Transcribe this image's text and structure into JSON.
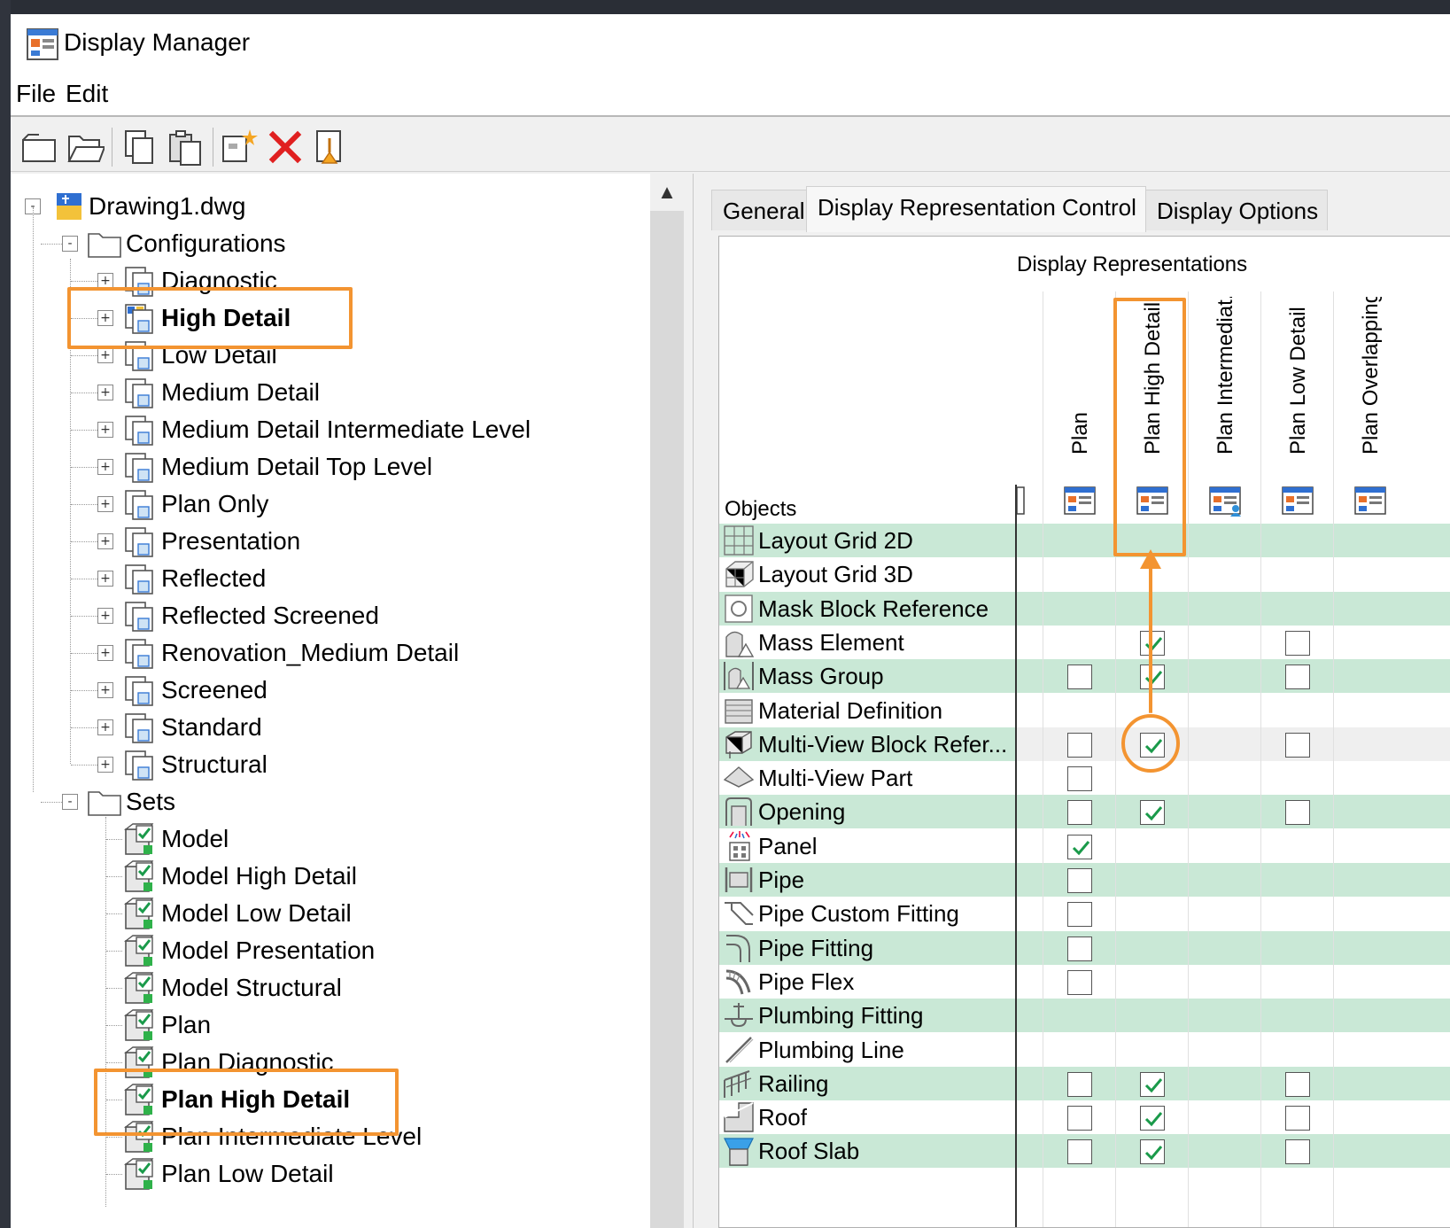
{
  "window": {
    "title": "Display Manager",
    "menu": [
      "File",
      "Edit"
    ],
    "toolbar": [
      "new-icon",
      "open-icon",
      "copy-icon",
      "paste-icon",
      "new-representation-icon",
      "delete-icon",
      "purge-icon"
    ]
  },
  "tree": {
    "root": "Drawing1.dwg",
    "configurations_label": "Configurations",
    "configurations": [
      "Diagnostic",
      "High Detail",
      "Low Detail",
      "Medium Detail",
      "Medium Detail Intermediate Level",
      "Medium Detail Top Level",
      "Plan Only",
      "Presentation",
      "Reflected",
      "Reflected Screened",
      "Renovation_Medium Detail",
      "Screened",
      "Standard",
      "Structural"
    ],
    "current_configuration": "High Detail",
    "sets_label": "Sets",
    "sets": [
      "Model",
      "Model High Detail",
      "Model Low Detail",
      "Model Presentation",
      "Model Structural",
      "Plan",
      "Plan Diagnostic",
      "Plan High Detail",
      "Plan Intermediate Level",
      "Plan Low Detail"
    ],
    "selected_set": "Plan High Detail"
  },
  "tabs": [
    "General",
    "Display Representation Control",
    "Display Options"
  ],
  "active_tab": "Display Representation Control",
  "grid": {
    "header": "Display Representations",
    "objects_label": "Objects",
    "columns": [
      "Plan",
      "Plan High Detail",
      "Plan Intermediat...",
      "Plan Low Detail",
      "Plan Overlapping"
    ],
    "rows": [
      {
        "name": "Layout Grid 2D",
        "icon": "layout-grid-2d-icon",
        "cells": [
          null,
          null,
          null,
          null,
          null
        ]
      },
      {
        "name": "Layout Grid 3D",
        "icon": "layout-grid-3d-icon",
        "cells": [
          null,
          null,
          null,
          null,
          null
        ]
      },
      {
        "name": "Mask Block Reference",
        "icon": "mask-block-icon",
        "cells": [
          null,
          null,
          null,
          null,
          null
        ]
      },
      {
        "name": "Mass Element",
        "icon": "mass-element-icon",
        "cells": [
          null,
          true,
          null,
          false,
          null
        ]
      },
      {
        "name": "Mass Group",
        "icon": "mass-group-icon",
        "cells": [
          false,
          true,
          null,
          false,
          null
        ]
      },
      {
        "name": "Material Definition",
        "icon": "material-definition-icon",
        "cells": [
          null,
          null,
          null,
          null,
          null
        ]
      },
      {
        "name": "Multi-View Block Refer...",
        "icon": "multi-view-block-icon",
        "cells": [
          false,
          true,
          null,
          false,
          null
        ]
      },
      {
        "name": "Multi-View Part",
        "icon": "multi-view-part-icon",
        "cells": [
          false,
          null,
          null,
          null,
          null
        ]
      },
      {
        "name": "Opening",
        "icon": "opening-icon",
        "cells": [
          false,
          true,
          null,
          false,
          null
        ]
      },
      {
        "name": "Panel",
        "icon": "panel-icon",
        "cells": [
          true,
          null,
          null,
          null,
          null
        ]
      },
      {
        "name": "Pipe",
        "icon": "pipe-icon",
        "cells": [
          false,
          null,
          null,
          null,
          null
        ]
      },
      {
        "name": "Pipe Custom Fitting",
        "icon": "pipe-custom-fitting-icon",
        "cells": [
          false,
          null,
          null,
          null,
          null
        ]
      },
      {
        "name": "Pipe Fitting",
        "icon": "pipe-fitting-icon",
        "cells": [
          false,
          null,
          null,
          null,
          null
        ]
      },
      {
        "name": "Pipe Flex",
        "icon": "pipe-flex-icon",
        "cells": [
          false,
          null,
          null,
          null,
          null
        ]
      },
      {
        "name": "Plumbing Fitting",
        "icon": "plumbing-fitting-icon",
        "cells": [
          null,
          null,
          null,
          null,
          null
        ]
      },
      {
        "name": "Plumbing Line",
        "icon": "plumbing-line-icon",
        "cells": [
          null,
          null,
          null,
          null,
          null
        ]
      },
      {
        "name": "Railing",
        "icon": "railing-icon",
        "cells": [
          false,
          true,
          null,
          false,
          null
        ]
      },
      {
        "name": "Roof",
        "icon": "roof-icon",
        "cells": [
          false,
          true,
          null,
          false,
          null
        ]
      },
      {
        "name": "Roof Slab",
        "icon": "roof-slab-icon",
        "cells": [
          false,
          true,
          null,
          false,
          null
        ]
      }
    ],
    "selected_row": "Multi-View Block Refer..."
  },
  "colors": {
    "alt_row": "#c9e8d6",
    "highlight": "#f39431",
    "check": "#1a9a4a"
  }
}
